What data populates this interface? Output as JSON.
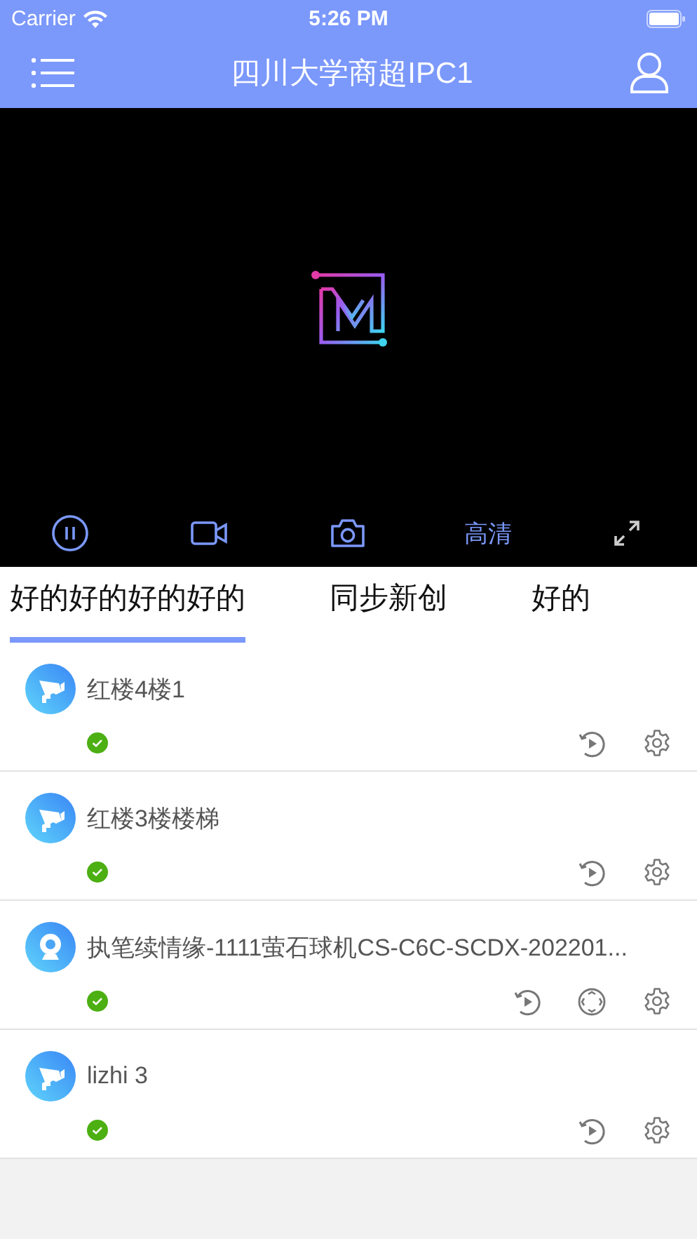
{
  "status_bar": {
    "carrier": "Carrier",
    "time": "5:26 PM"
  },
  "nav": {
    "title": "四川大学商超IPC1"
  },
  "player": {
    "paused": false,
    "quality": "高清"
  },
  "tabs": [
    {
      "label": "好的好的好的好的",
      "selected": true
    },
    {
      "label": "同步新创",
      "selected": false
    },
    {
      "label": "好的",
      "selected": false
    }
  ],
  "devices": [
    {
      "kind": "bullet",
      "name": "红楼4楼1",
      "online": true,
      "ptz": false
    },
    {
      "kind": "bullet",
      "name": "红楼3楼楼梯",
      "online": true,
      "ptz": false
    },
    {
      "kind": "dome",
      "name": "执笔续情缘-1111萤石球机CS-C6C-SCDX-202201...",
      "online": true,
      "ptz": true
    },
    {
      "kind": "bullet",
      "name": "lizhi 3",
      "online": true,
      "ptz": false
    }
  ]
}
